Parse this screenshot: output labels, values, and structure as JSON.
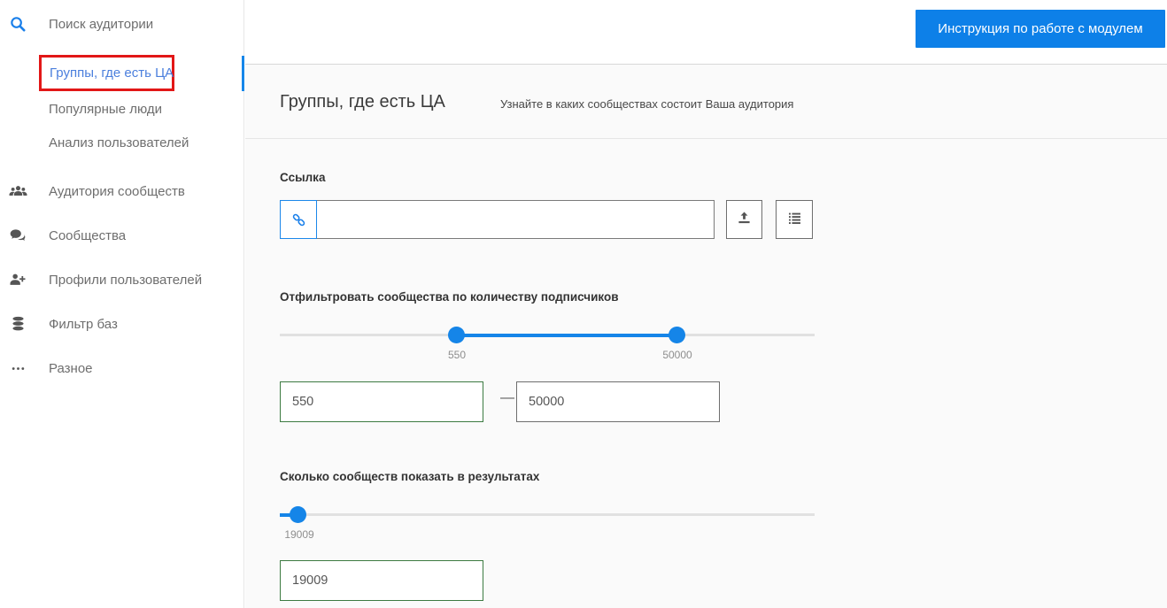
{
  "sidebar": {
    "items": [
      {
        "label": "Поиск аудитории",
        "icon": "search-icon"
      },
      {
        "label": "Группы, где есть ЦА",
        "selected": true
      },
      {
        "label": "Популярные люди"
      },
      {
        "label": "Анализ пользователей"
      },
      {
        "label": "Аудитория сообществ",
        "icon": "users-icon"
      },
      {
        "label": "Сообщества",
        "icon": "comments-icon"
      },
      {
        "label": "Профили пользователей",
        "icon": "user-plus-icon"
      },
      {
        "label": "Фильтр баз",
        "icon": "database-icon"
      },
      {
        "label": "Разное",
        "icon": "ellipsis-icon"
      }
    ]
  },
  "topbar": {
    "instruction_button_label": "Инструкция по работе с модулем"
  },
  "main": {
    "title": "Группы, где есть ЦА",
    "subtitle": "Узнайте в каких сообществах состоит Ваша аудитория",
    "link_section": {
      "label": "Ссылка",
      "input_value": "",
      "input_placeholder": "",
      "icons": [
        "link-icon",
        "upload-icon",
        "list-icon"
      ]
    },
    "subscribers_filter": {
      "label": "Отфильтровать сообщества по количеству подписчиков",
      "min_value": "550",
      "max_value": "50000",
      "separator": "—"
    },
    "results_limit": {
      "label": "Сколько сообществ показать в результатах",
      "value": "19009"
    }
  },
  "colors": {
    "accent_blue": "#0d80e8",
    "slider_blue": "#1585e8",
    "selected_item_blue": "#4b7fdd",
    "annotation_red": "#e21717",
    "input_green_border": "#3c7a41",
    "content_background": "#fafafa"
  }
}
